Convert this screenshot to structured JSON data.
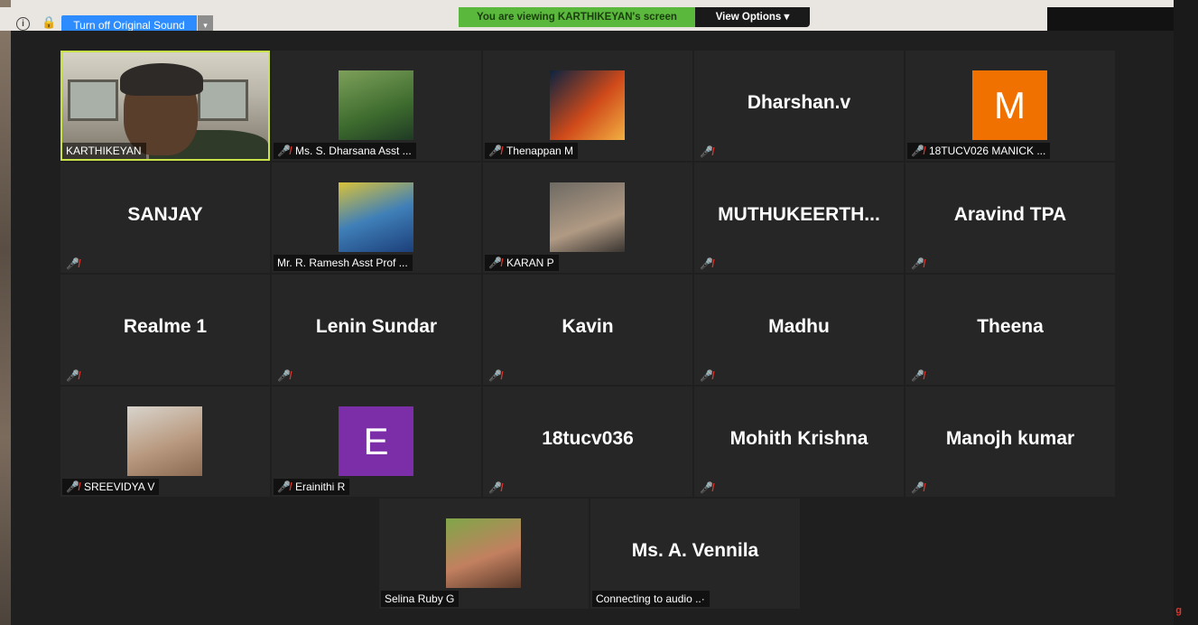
{
  "header": {
    "sound_button": "Turn off Original Sound",
    "viewing_banner": "You are viewing KARTHIKEYAN's screen",
    "view_options": "View Options"
  },
  "icons": {
    "info": "info-icon",
    "lock": "lock-icon",
    "mic_muted": "mic-muted-icon",
    "chevron": "chevron-down-icon",
    "info_glyph": "i",
    "lock_glyph": "🔒",
    "chevron_glyph": "▾",
    "mute_glyph": "🎤̸"
  },
  "colors": {
    "accent": "#2d8cff",
    "viewing_green": "#5ab83c",
    "mute_red": "#e2352b",
    "speaker_border": "#c9e24a"
  },
  "participants": [
    {
      "label": "KARTHIKEYAN",
      "type": "video",
      "muted": false,
      "speaking": true
    },
    {
      "label": "Ms. S. Dharsana Asst ...",
      "type": "photo",
      "muted": true
    },
    {
      "label": "Thenappan M",
      "type": "photo",
      "muted": true
    },
    {
      "display": "Dharshan.v",
      "type": "name",
      "muted": true
    },
    {
      "label": "18TUCV026 MANICK ...",
      "type": "letter",
      "letter": "M",
      "letter_color": "#f07000",
      "muted": true
    },
    {
      "display": "SANJAY",
      "type": "name",
      "muted": true
    },
    {
      "label": "Mr. R. Ramesh Asst Prof ...",
      "type": "photo",
      "muted": false
    },
    {
      "label": "KARAN P",
      "type": "photo",
      "muted": true
    },
    {
      "display": "MUTHUKEERTH...",
      "type": "name",
      "muted": true
    },
    {
      "display": "Aravind TPA",
      "type": "name",
      "muted": true
    },
    {
      "display": "Realme 1",
      "type": "name",
      "muted": true
    },
    {
      "display": "Lenin Sundar",
      "type": "name",
      "muted": true
    },
    {
      "display": "Kavin",
      "type": "name",
      "muted": true
    },
    {
      "display": "Madhu",
      "type": "name",
      "muted": true
    },
    {
      "display": "Theena",
      "type": "name",
      "muted": true
    },
    {
      "label": "SREEVIDYA V",
      "type": "photo",
      "muted": true
    },
    {
      "label": "Erainithi R",
      "type": "letter",
      "letter": "E",
      "letter_color": "#7b2ea8",
      "muted": true
    },
    {
      "display": "18tucv036",
      "type": "name",
      "muted": true
    },
    {
      "display": "Mohith Krishna",
      "type": "name",
      "muted": true
    },
    {
      "display": "Manojh kumar",
      "type": "name",
      "muted": true
    },
    {
      "label": "Selina Ruby G",
      "type": "photo",
      "muted": false
    },
    {
      "display": "Ms. A. Vennila",
      "label": "Connecting to audio ..·",
      "type": "name",
      "muted": false
    }
  ]
}
